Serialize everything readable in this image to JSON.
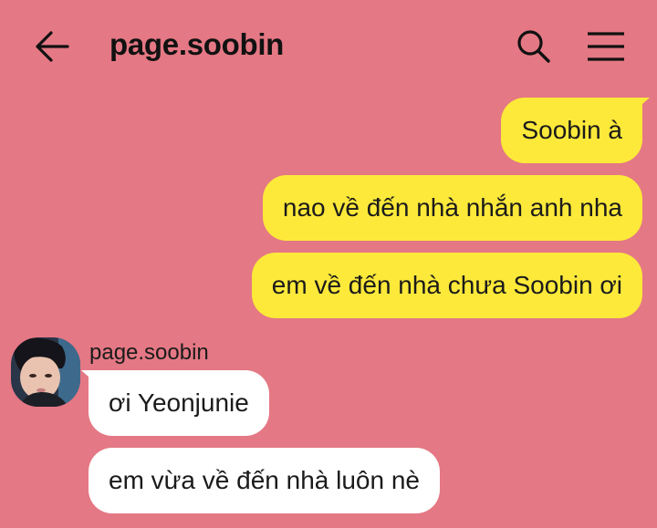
{
  "header": {
    "title": "page.soobin",
    "back_icon": "arrow-left-icon",
    "search_icon": "search-icon",
    "menu_icon": "hamburger-menu-icon"
  },
  "colors": {
    "background": "#e47884",
    "outgoing_bubble": "#fde93a",
    "incoming_bubble": "#ffffff",
    "text": "#111111"
  },
  "messages": {
    "outgoing": [
      {
        "text": "Soobin à"
      },
      {
        "text": "nao về đến nhà nhắn anh nha"
      },
      {
        "text": "em về đến nhà chưa Soobin ơi"
      }
    ],
    "incoming_sender": "page.soobin",
    "incoming": [
      {
        "text": "ơi Yeonjunie"
      },
      {
        "text": "em vừa về đến nhà luôn nè"
      }
    ]
  }
}
